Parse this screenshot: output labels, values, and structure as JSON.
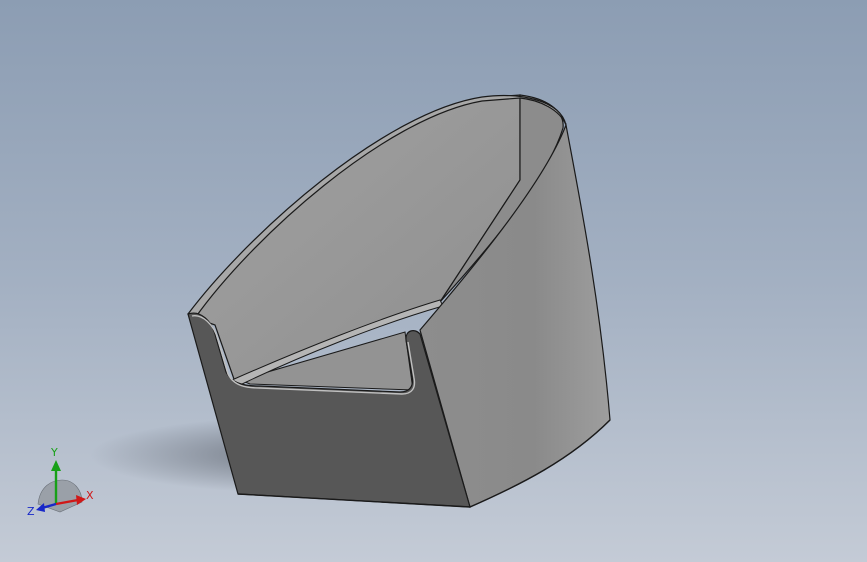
{
  "viewport": {
    "background_top": "#8c9db3",
    "background_bottom": "#c4cbd6"
  },
  "model": {
    "face_color": "#8a8a8a",
    "inner_color": "#9a9a9a",
    "dark_face_color": "#555555",
    "edge_color": "#1a1a1a"
  },
  "triad": {
    "x_label": "X",
    "y_label": "Y",
    "z_label": "Z",
    "x_color": "#d01818",
    "y_color": "#18a018",
    "z_color": "#1828c8"
  }
}
